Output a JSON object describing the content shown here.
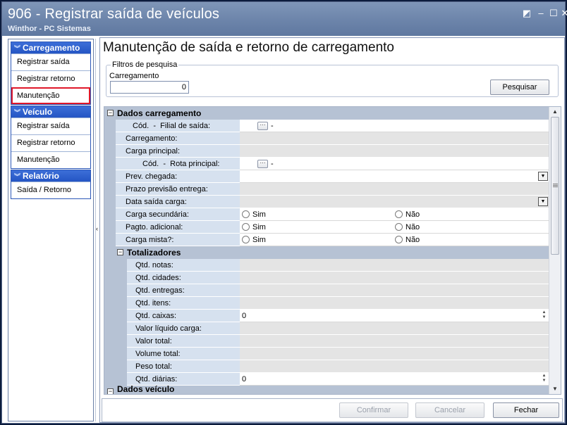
{
  "window": {
    "title": "906 - Registrar saída de veículos",
    "subtitle": "Winthor - PC Sistemas"
  },
  "sidebar": {
    "groups": [
      {
        "label": "Carregamento",
        "items": [
          "Registrar saída",
          "Registrar retorno",
          "Manutenção"
        ]
      },
      {
        "label": "Veículo",
        "items": [
          "Registrar saída",
          "Registrar retorno",
          "Manutenção"
        ]
      },
      {
        "label": "Relatório",
        "items": [
          "Saída / Retorno"
        ]
      }
    ],
    "selected": "Carregamento / Manutenção"
  },
  "main": {
    "title": "Manutenção de saída e retorno de carregamento",
    "filters": {
      "legend": "Filtros de pesquisa",
      "carregamento_label": "Carregamento",
      "carregamento_value": "0",
      "search_button": "Pesquisar"
    }
  },
  "grid": {
    "cat1": "Dados carregamento",
    "cat2": "Totalizadores",
    "cat3": "Dados veículo",
    "cod_label": "Cód.",
    "dash": "-",
    "filial_label": "Filial de saída:",
    "carregamento_label": "Carregamento:",
    "carga_principal_label": "Carga principal:",
    "rota_label": "Rota principal:",
    "prev_chegada_label": "Prev. chegada:",
    "prazo_label": "Prazo previsão entrega:",
    "data_saida_label": "Data saída carga:",
    "carga_sec_label": "Carga secundária:",
    "pagto_label": "Pagto. adicional:",
    "carga_mista_label": "Carga mista?:",
    "sim": "Sim",
    "nao": "Não",
    "qtd_notas": "Qtd. notas:",
    "qtd_cidades": "Qtd. cidades:",
    "qtd_entregas": "Qtd. entregas:",
    "qtd_itens": "Qtd. itens:",
    "qtd_caixas": "Qtd. caixas:",
    "qtd_caixas_value": "0",
    "valor_liquido": "Valor líquido carga:",
    "valor_total": "Valor total:",
    "volume_total": "Volume total:",
    "peso_total": "Peso total:",
    "qtd_diarias": "Qtd. diárias:",
    "qtd_diarias_value": "0"
  },
  "footer": {
    "confirm": "Confirmar",
    "cancel": "Cancelar",
    "close": "Fechar"
  },
  "colors": {
    "titlebar": "#6c84aa",
    "sidebar_header": "#2455c4",
    "selection_outline": "#e0182a",
    "grid_label_bg": "#d6e1ef",
    "grid_category_bg": "#b6c2d4"
  }
}
